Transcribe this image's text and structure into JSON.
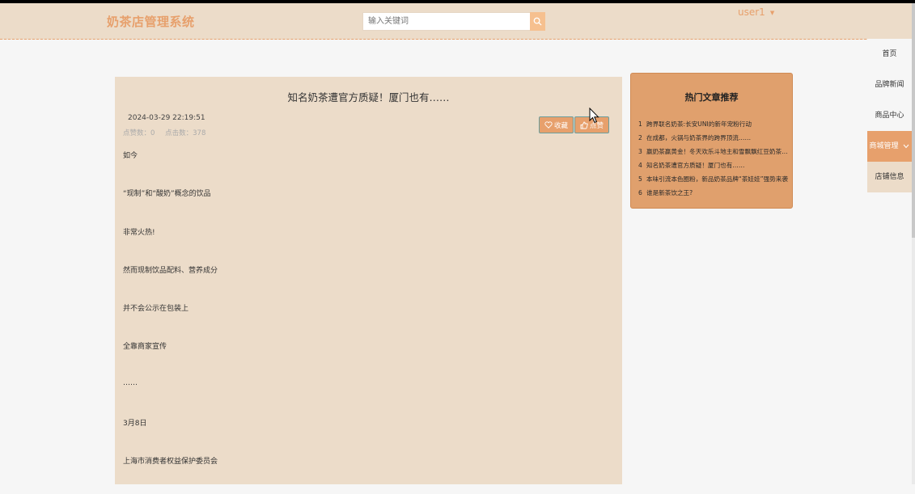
{
  "header": {
    "logo": "奶茶店管理系统",
    "search_placeholder": "输入关键词",
    "search_icon": "search-icon",
    "user": "user1"
  },
  "nav": {
    "items": [
      {
        "label": "首页"
      },
      {
        "label": "品牌新闻"
      },
      {
        "label": "商品中心"
      },
      {
        "label": "商城管理"
      },
      {
        "label": "店铺信息"
      }
    ]
  },
  "article": {
    "title": "知名奶茶遭官方质疑！厦门也有……",
    "date": "2024-03-29 22:19:51",
    "likes_label": "点赞数：0",
    "clicks_label": "点击数：378",
    "collect_label": "收藏",
    "like_label": "点赞",
    "paragraphs": [
      "如今",
      "“现制”和“酸奶”概念的饮品",
      "非常火热!",
      "然而现制饮品配料、营养成分",
      "并不会公示在包装上",
      "全靠商家宣传",
      "……",
      "3月8日",
      "上海市消费者权益保护委员会"
    ]
  },
  "hot": {
    "title": "热门文章推荐",
    "items": [
      {
        "num": "1",
        "text": "跨界联名奶茶:长安UNI的新年宠粉行动"
      },
      {
        "num": "2",
        "text": "在成都，火锅与奶茶界的跨界顶流……"
      },
      {
        "num": "3",
        "text": "赢奶茶赢黄金！冬天欢乐斗地主和雪飘飘红豆奶茶更配哦"
      },
      {
        "num": "4",
        "text": "知名奶茶遭官方质疑！厦门也有……"
      },
      {
        "num": "5",
        "text": "本味引流本色圈粉，新品奶茶品牌“茶娃娃”强势来袭"
      },
      {
        "num": "6",
        "text": "谁是新茶饮之王?"
      }
    ]
  },
  "colors": {
    "accent": "#e7a06c",
    "header_bg": "#ecdcc9",
    "panel_bg": "#e0a06d"
  }
}
